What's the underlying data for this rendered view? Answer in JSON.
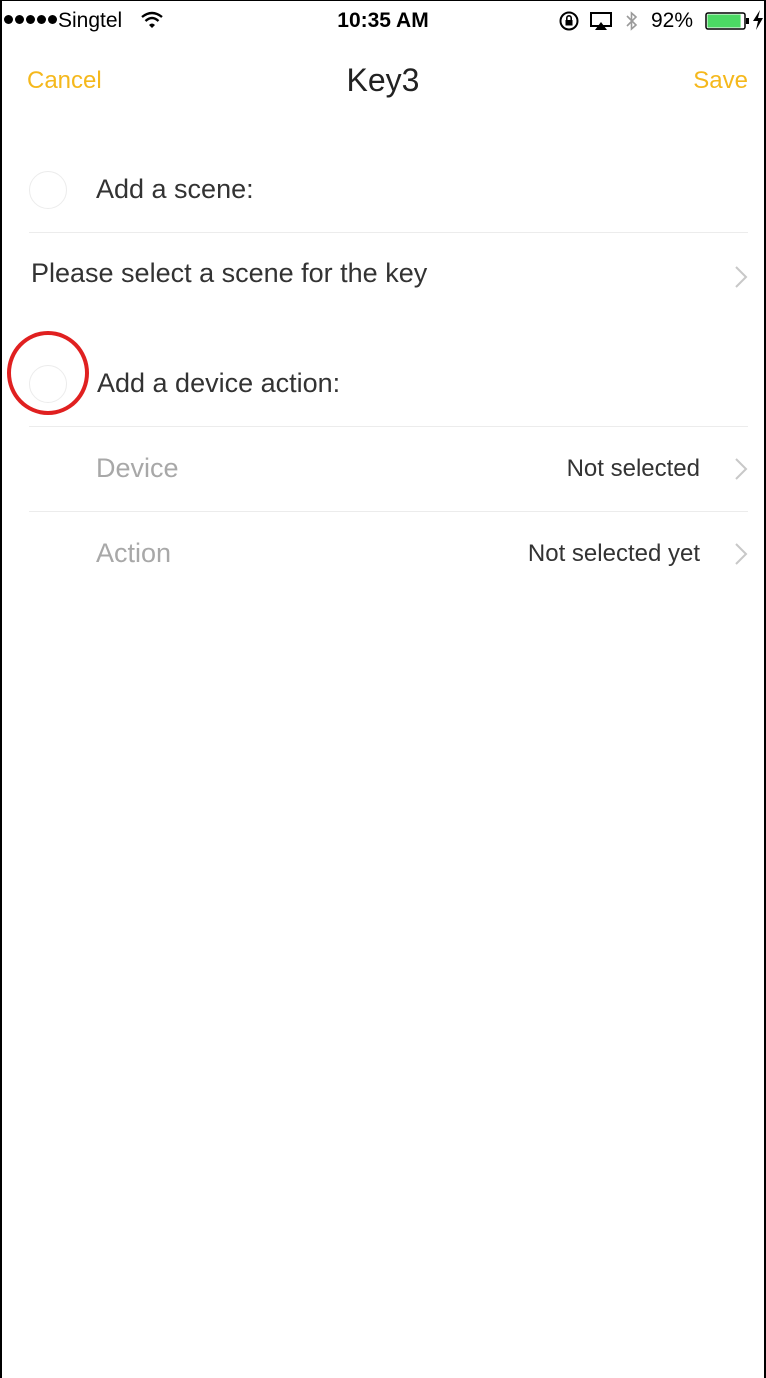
{
  "status_bar": {
    "carrier": "Singtel",
    "time": "10:35 AM",
    "battery_percent": "92%",
    "battery_level": 0.92,
    "icons": [
      "signal-dots-icon",
      "wifi-icon",
      "orientation-lock-icon",
      "airplay-icon",
      "bluetooth-icon",
      "battery-icon",
      "charging-icon"
    ]
  },
  "nav": {
    "cancel_label": "Cancel",
    "title": "Key3",
    "save_label": "Save"
  },
  "scene_section": {
    "label": "Add a scene:",
    "selected": false,
    "row_text": "Please select a scene for the key"
  },
  "device_section": {
    "label": "Add a device action:",
    "selected": false,
    "highlighted": true,
    "rows": [
      {
        "label": "Device",
        "value": "Not selected"
      },
      {
        "label": "Action",
        "value": "Not selected yet"
      }
    ]
  },
  "colors": {
    "accent": "#f5b81c",
    "highlight": "#e02020",
    "muted_text": "#a8a8a8",
    "divider": "#ececec"
  }
}
